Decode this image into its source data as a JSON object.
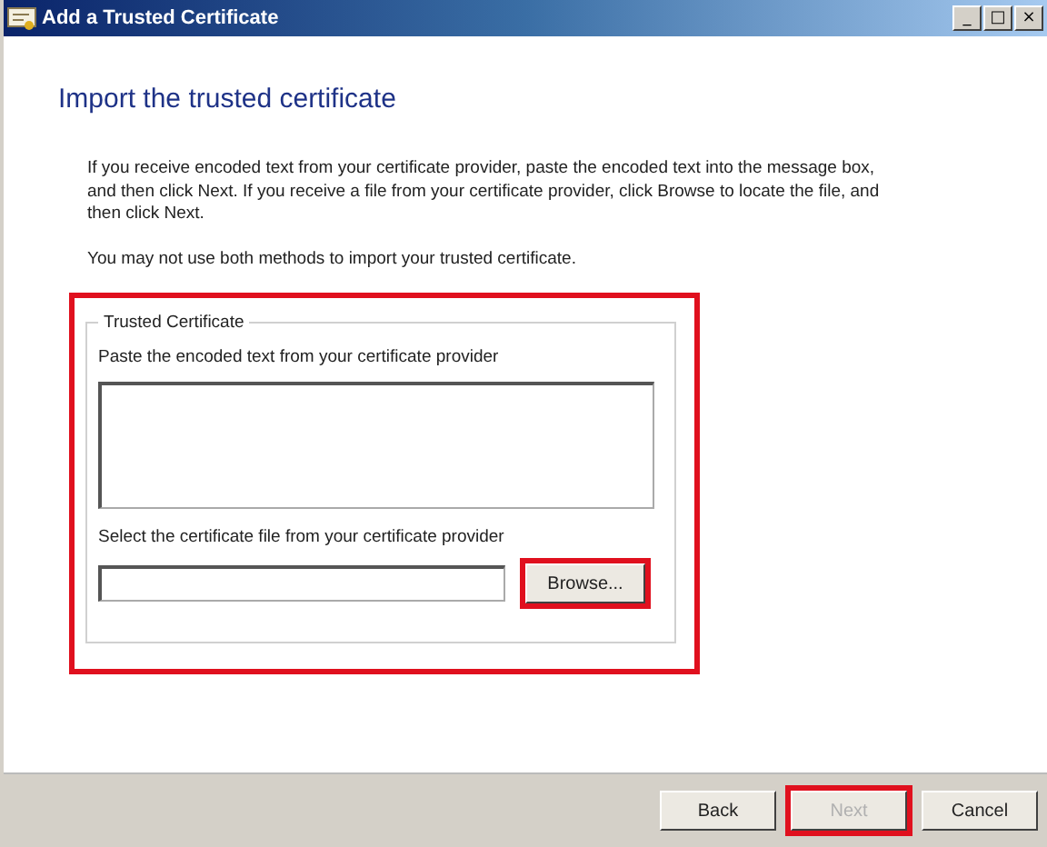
{
  "window": {
    "title": "Add a Trusted Certificate",
    "controls": [
      "_",
      "□",
      "×"
    ]
  },
  "heading": "Import the trusted certificate",
  "paragraphs": [
    "If you receive encoded text from your certificate provider, paste the encoded text into the message box, and then click Next. If you receive a file from your certificate provider, click Browse to locate the file, and then click Next.",
    "You may not use both methods to import your trusted certificate."
  ],
  "group": {
    "title": "Trusted Certificate",
    "highlighted": true,
    "paste_label": "Paste the encoded text from your certificate provider",
    "file_label": "Select the certificate file from your certificate provider",
    "browse": {
      "label": "Browse...",
      "highlighted": true
    }
  },
  "buttons": [
    {
      "label": "Back",
      "disabled": false,
      "highlighted": false
    },
    {
      "label": "Next",
      "disabled": true,
      "highlighted": true
    },
    {
      "label": "Cancel",
      "disabled": false,
      "highlighted": false
    }
  ]
}
